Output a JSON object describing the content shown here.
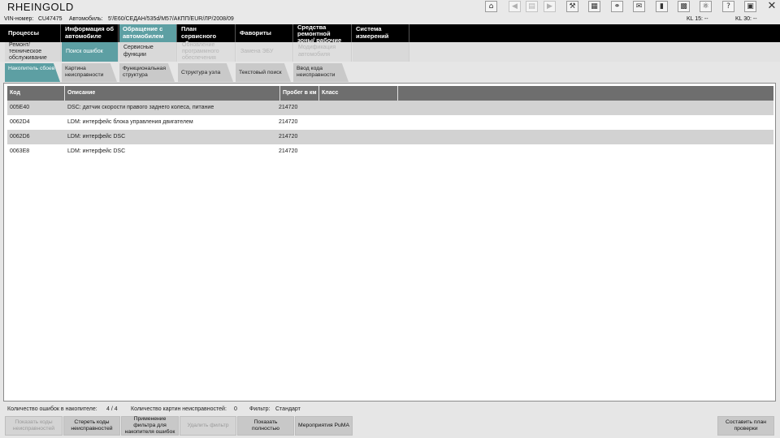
{
  "app": {
    "title": "RHEINGOLD"
  },
  "toolbar": {
    "icons": [
      "home-icon",
      "back-icon",
      "print-preview-icon",
      "forward-icon",
      "wrench-icon",
      "calculator-icon",
      "link-icon",
      "mail-icon",
      "battery-icon",
      "monitor-icon",
      "connection-icon",
      "help-icon",
      "window-icon",
      "close-icon"
    ],
    "help_glyph": "?",
    "close_glyph": "✕"
  },
  "vehicle": {
    "vin_label": "VIN-номер:",
    "vin_value": "CU47475",
    "car_label": "Автомобиль:",
    "car_value": "5'/E60/СЕДАН/535d/M57/АКПП/EUR/ЛР/2008/09",
    "kl15": "KL 15:  --",
    "kl30": "KL 30:  --"
  },
  "main_nav": [
    {
      "label": "Процессы"
    },
    {
      "label": "Информация об автомобиле"
    },
    {
      "label": "Обращение с автомобилем"
    },
    {
      "label": "План сервисного обслуживания"
    },
    {
      "label": "Фавориты"
    },
    {
      "label": "Средства ремонтной зоны/ рабочие жидкости"
    },
    {
      "label": "Система измерений"
    }
  ],
  "sub_nav": [
    {
      "label": "Ремонт/ техническое обслуживание"
    },
    {
      "label": "Поиск ошибок"
    },
    {
      "label": "Сервисные функции"
    },
    {
      "label": "Обновление программного обеспечения"
    },
    {
      "label": "Замена ЭБУ"
    },
    {
      "label": "Модификация автомобиля"
    }
  ],
  "tabs": [
    {
      "label": "Накопитель сбоев"
    },
    {
      "label": "Картина неисправности"
    },
    {
      "label": "Функциональная структура"
    },
    {
      "label": "Структура узла"
    },
    {
      "label": "Текстовый поиск"
    },
    {
      "label": "Ввод кода неисправности"
    }
  ],
  "table": {
    "columns": [
      "Код",
      "Описание",
      "Пробег в км",
      "Класс"
    ],
    "rows": [
      {
        "code": "005E40",
        "description": "DSC: датчик скорости правого заднего колеса, питание",
        "mileage": "214720",
        "class": ""
      },
      {
        "code": "0062D4",
        "description": "LDM: интерфейс блока управления двигателем",
        "mileage": "214720",
        "class": ""
      },
      {
        "code": "0062D6",
        "description": "LDM: интерфейс DSC",
        "mileage": "214720",
        "class": ""
      },
      {
        "code": "0063E8",
        "description": "LDM: интерфейс DSC",
        "mileage": "214720",
        "class": ""
      }
    ]
  },
  "summary": {
    "errors_label": "Количество ошибок в накопителе:",
    "errors_value": "4 / 4",
    "pictures_label": "Количество картин неисправностей:",
    "pictures_value": "0",
    "filter_label": "Фильтр:",
    "filter_value": "Стандарт"
  },
  "bottom_buttons": [
    {
      "label": "Показать коды неисправностей"
    },
    {
      "label": "Стереть коды неисправностей"
    },
    {
      "label": "Применение фильтра для накопителя ошибок"
    },
    {
      "label": "Удалить фильтр"
    },
    {
      "label": "Показать полностью"
    },
    {
      "label": "Мероприятия PuMA"
    },
    {
      "label": "Составить план проверки"
    }
  ]
}
